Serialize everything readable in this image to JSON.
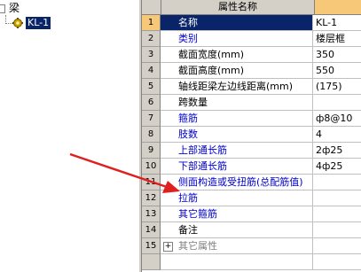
{
  "tree": {
    "root_label": "梁",
    "child_label": "KL-1"
  },
  "grid": {
    "header_name": "属性名称",
    "rows": [
      {
        "num": "1",
        "name": "名称",
        "value": "KL-1"
      },
      {
        "num": "2",
        "name": "类别",
        "value": "楼层框"
      },
      {
        "num": "3",
        "name": "截面宽度(mm)",
        "value": "350"
      },
      {
        "num": "4",
        "name": "截面高度(mm)",
        "value": "550"
      },
      {
        "num": "5",
        "name": "轴线距梁左边线距离(mm)",
        "value": "(175)"
      },
      {
        "num": "6",
        "name": "跨数量",
        "value": ""
      },
      {
        "num": "7",
        "name": "箍筋",
        "value": "ф8@10"
      },
      {
        "num": "8",
        "name": "肢数",
        "value": "4"
      },
      {
        "num": "9",
        "name": "上部通长筋",
        "value": "2ф25"
      },
      {
        "num": "10",
        "name": "下部通长筋",
        "value": "4ф25"
      },
      {
        "num": "11",
        "name": "侧面构造或受扭筋(总配筋值)",
        "value": ""
      },
      {
        "num": "12",
        "name": "拉筋",
        "value": ""
      },
      {
        "num": "13",
        "name": "其它箍筋",
        "value": ""
      },
      {
        "num": "14",
        "name": "备注",
        "value": ""
      },
      {
        "num": "15",
        "name": "其它属性",
        "value": ""
      }
    ]
  },
  "colors": {
    "selection": "#0a246a",
    "header_value_bg": "#f6c878",
    "blue_text": "#0000cc",
    "arrow": "#e02020"
  }
}
